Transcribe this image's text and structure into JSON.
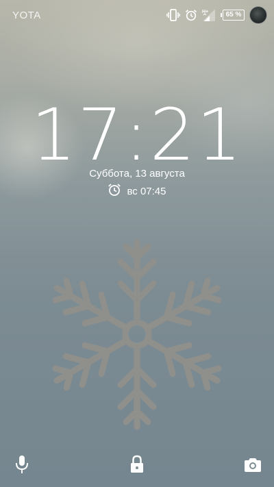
{
  "status_bar": {
    "carrier": "YOTA",
    "battery_percent": "65 %",
    "icons": [
      "vibrate-icon",
      "alarm-icon",
      "signal-icon",
      "battery-icon",
      "avatar"
    ]
  },
  "lock_screen": {
    "time": "17:21",
    "date": "Суббота, 13 августа",
    "next_alarm": "вс 07:45",
    "wallpaper_icon": "snowflake-icon"
  },
  "bottom_bar": {
    "left": "microphone-icon",
    "center": "lock-icon",
    "right": "camera-icon"
  },
  "colors": {
    "text": "#ffffff",
    "snowflake": "#8f8f8b"
  }
}
